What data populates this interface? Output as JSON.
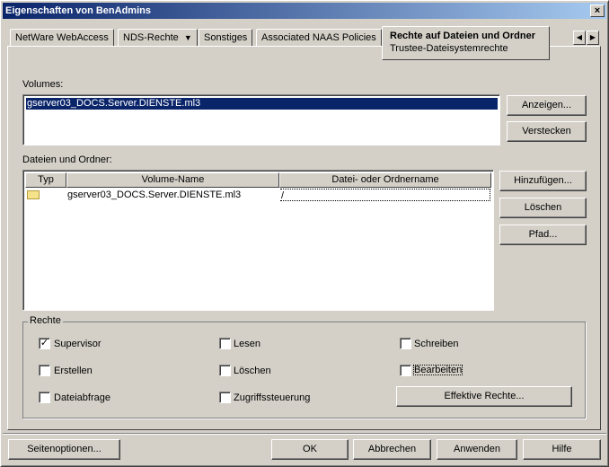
{
  "window": {
    "title": "Eigenschaften von BenAdmins",
    "close": "×"
  },
  "tabs": [
    {
      "label": "NetWare WebAccess"
    },
    {
      "label": "NDS-Rechte",
      "arrow": "▼"
    },
    {
      "label": "Sonstiges"
    },
    {
      "label": "Associated NAAS Policies"
    }
  ],
  "active_tab": {
    "label": "Rechte auf Dateien und Ordner",
    "sublabel": "Trustee-Dateisystemrechte"
  },
  "tab_scroll": {
    "left": "◀",
    "right": "▶"
  },
  "volumes": {
    "label": "Volumes:",
    "items": [
      "gserver03_DOCS.Server.DIENSTE.ml3"
    ],
    "buttons": {
      "show": "Anzeigen...",
      "hide": "Verstecken"
    }
  },
  "files": {
    "label": "Dateien und Ordner:",
    "columns": [
      "Typ",
      "Volume-Name",
      "Datei- oder Ordnername"
    ],
    "rows": [
      {
        "type": "folder-icon",
        "volume": "gserver03_DOCS.Server.DIENSTE.ml3",
        "path": "/"
      }
    ],
    "buttons": {
      "add": "Hinzufügen...",
      "delete": "Löschen",
      "path": "Pfad..."
    }
  },
  "rights": {
    "title": "Rechte",
    "items": [
      {
        "label": "Supervisor",
        "checked": true
      },
      {
        "label": "Lesen",
        "checked": false
      },
      {
        "label": "Schreiben",
        "checked": false
      },
      {
        "label": "Erstellen",
        "checked": false
      },
      {
        "label": "Löschen",
        "checked": false
      },
      {
        "label": "Bearbeiten",
        "checked": false
      },
      {
        "label": "Dateiabfrage",
        "checked": false
      },
      {
        "label": "Zugriffssteuerung",
        "checked": false
      }
    ],
    "effective_button": "Effektive Rechte..."
  },
  "footer": {
    "page_options": "Seitenoptionen...",
    "ok": "OK",
    "cancel": "Abbrechen",
    "apply": "Anwenden",
    "help": "Hilfe"
  }
}
